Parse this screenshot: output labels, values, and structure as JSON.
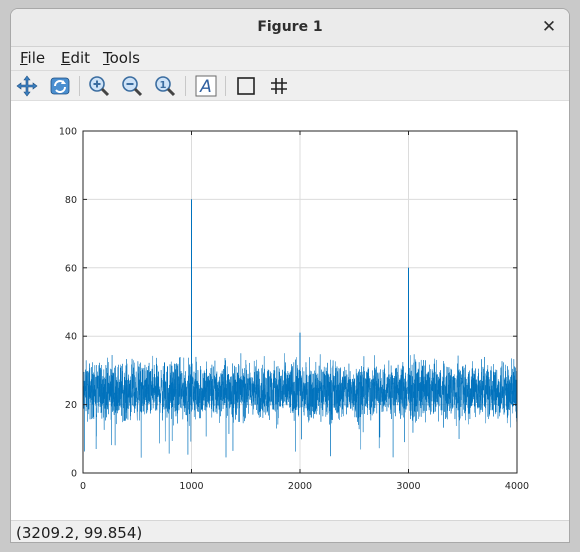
{
  "window": {
    "title": "Figure 1"
  },
  "menu": [
    {
      "mnemonic": "F",
      "rest": "ile"
    },
    {
      "mnemonic": "E",
      "rest": "dit"
    },
    {
      "mnemonic": "T",
      "rest": "ools"
    }
  ],
  "toolbar": {
    "icons": [
      "pan-icon",
      "rotate-icon",
      "zoom-in-icon",
      "zoom-out-icon",
      "zoom-reset-icon",
      "text-insert-icon",
      "axes-box-icon",
      "grid-icon"
    ]
  },
  "status": {
    "coords": "(3209.2, 99.854)"
  },
  "colors": {
    "series": "#0072bd",
    "grid": "#dcdcdc",
    "axis": "#262626"
  },
  "chart_data": {
    "type": "line",
    "title": "",
    "xlabel": "",
    "ylabel": "",
    "xlim": [
      0,
      4000
    ],
    "ylim": [
      0,
      100
    ],
    "xticks": [
      0,
      1000,
      2000,
      3000,
      4000
    ],
    "yticks": [
      0,
      20,
      40,
      60,
      80,
      100
    ],
    "grid": true,
    "series": [
      {
        "n_points": 4000,
        "baseline_mean": 24,
        "baseline_range": [
          4,
          35
        ],
        "peaks": [
          {
            "x": 1000,
            "y": 80
          },
          {
            "x": 2000,
            "y": 41
          },
          {
            "x": 3000,
            "y": 60
          }
        ]
      }
    ]
  }
}
